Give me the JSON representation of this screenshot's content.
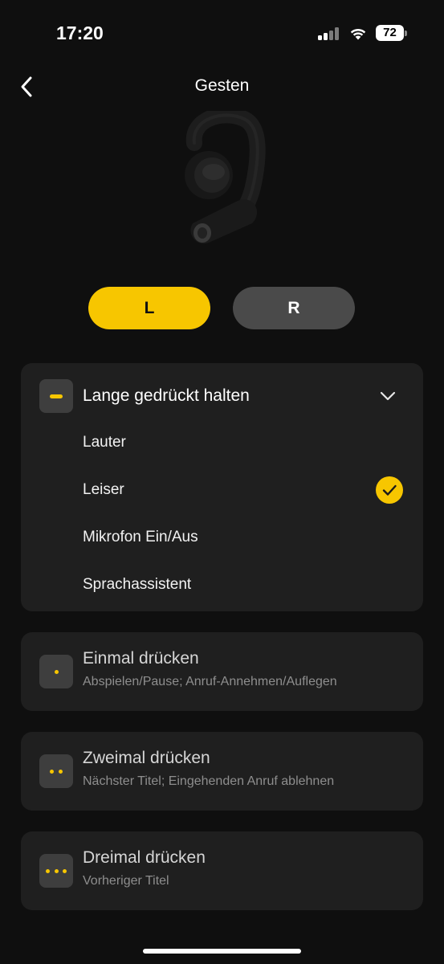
{
  "status_bar": {
    "time": "17:20",
    "battery_level": "72",
    "icons": [
      "cellular-signal-icon",
      "wifi-icon",
      "battery-icon"
    ]
  },
  "header": {
    "title": "Gesten",
    "back_icon": "chevron-left-icon"
  },
  "device_image": "open-ear-earbud-image",
  "side_selector": {
    "left_label": "L",
    "right_label": "R",
    "selected": "L",
    "active_color": "#f7c600",
    "inactive_color": "#4a4a4a"
  },
  "gestures": {
    "long_press": {
      "title": "Lange gedrückt halten",
      "icon": "dash-icon",
      "expanded": true,
      "options": [
        {
          "label": "Lauter",
          "selected": false
        },
        {
          "label": "Leiser",
          "selected": true
        },
        {
          "label": "Mikrofon Ein/Aus",
          "selected": false
        },
        {
          "label": "Sprachassistent",
          "selected": false
        }
      ]
    },
    "single_press": {
      "title": "Einmal drücken",
      "subtitle": "Abspielen/Pause; Anruf-Annehmen/Auflegen",
      "icon": "one-dot-icon"
    },
    "double_press": {
      "title": "Zweimal drücken",
      "subtitle": "Nächster Titel; Eingehenden Anruf ablehnen",
      "icon": "two-dots-icon"
    },
    "triple_press": {
      "title": "Dreimal drücken",
      "subtitle": "Vorheriger Titel",
      "icon": "three-dots-icon"
    }
  },
  "colors": {
    "accent": "#f7c600",
    "background": "#0f0f0f",
    "card": "#1f1f1f"
  }
}
